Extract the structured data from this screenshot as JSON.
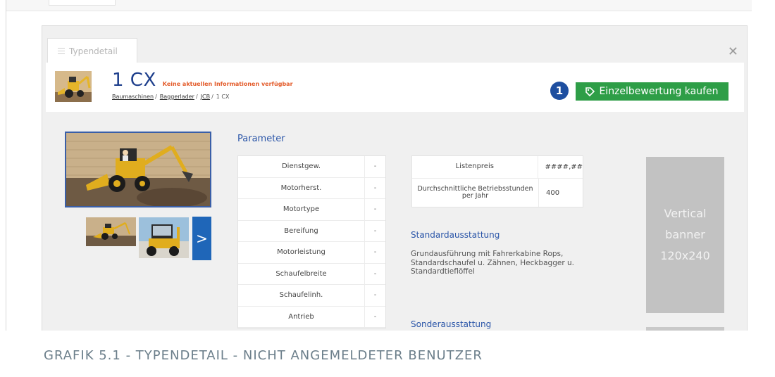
{
  "tab": {
    "label": "Typendetail"
  },
  "header": {
    "title": "1 CX",
    "no_info": "Keine aktuellen Informationen verfügbar",
    "breadcrumb": [
      "Baumaschinen",
      "Baggerlader",
      "JCB",
      "1 CX"
    ]
  },
  "actions": {
    "badge": "1",
    "buy_label": "Einzelbewertung kaufen",
    "buy_icon": "tag-icon",
    "next_label": ">"
  },
  "parameter": {
    "title": "Parameter",
    "rows": [
      {
        "name": "Dienstgew.",
        "value": "-"
      },
      {
        "name": "Motorherst.",
        "value": "-"
      },
      {
        "name": "Motortype",
        "value": "-"
      },
      {
        "name": "Bereifung",
        "value": "-"
      },
      {
        "name": "Motorleistung",
        "value": "-"
      },
      {
        "name": "Schaufelbreite",
        "value": "-"
      },
      {
        "name": "Schaufelinh.",
        "value": "-"
      },
      {
        "name": "Antrieb",
        "value": "-"
      }
    ]
  },
  "prices": [
    {
      "name": "Listenpreis",
      "value": "####,##"
    },
    {
      "name": "Durchschnittliche Betriebsstunden per Jahr",
      "value": "400"
    }
  ],
  "standard": {
    "title": "Standardausstattung",
    "text": "Grundausführung mit Fahrerkabine Rops, Standardschaufel u. Zähnen, Heckbagger u. Standardtieflöffel"
  },
  "sonder": {
    "title": "Sonderausstattung"
  },
  "banner": {
    "line1": "Vertical",
    "line2": "banner",
    "line3": "120x240"
  },
  "caption": "GRAFIK 5.1 - TYPENDETAIL - NICHT ANGEMELDETER BENUTZER",
  "colors": {
    "title_blue": "#1e3f8c",
    "accent_orange": "#e35b2a",
    "buy_green": "#2e9e47",
    "badge_blue": "#1e4fa0",
    "link_blue": "#2a55a8"
  }
}
